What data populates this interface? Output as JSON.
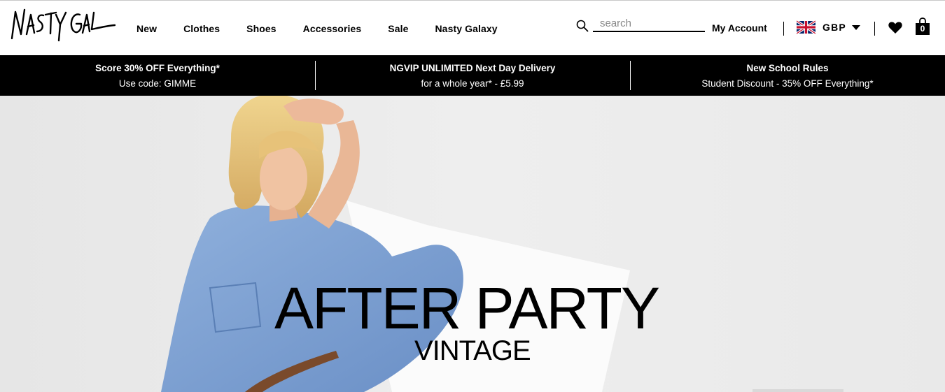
{
  "brand": {
    "logo_text": "NASTY GAL"
  },
  "nav": {
    "items": [
      {
        "label": "New"
      },
      {
        "label": "Clothes"
      },
      {
        "label": "Shoes"
      },
      {
        "label": "Accessories"
      },
      {
        "label": "Sale"
      },
      {
        "label": "Nasty Galaxy"
      }
    ]
  },
  "search": {
    "placeholder": "search",
    "icon": "search-icon"
  },
  "account": {
    "label": "My Account"
  },
  "locale": {
    "currency": "GBP",
    "flag": "uk-flag-icon"
  },
  "wishlist": {
    "icon": "heart-icon"
  },
  "cart": {
    "icon": "bag-icon",
    "count": "0"
  },
  "promos": [
    {
      "title": "Score 30% OFF Everything*",
      "subtitle": "Use code: GIMME"
    },
    {
      "title": "NGVIP UNLIMITED Next Day Delivery",
      "subtitle": "for a whole year* - £5.99"
    },
    {
      "title": "New School Rules",
      "subtitle": "Student Discount - 35% OFF Everything*"
    }
  ],
  "hero": {
    "title": "AFTER PARTY",
    "subtitle": "VINTAGE"
  },
  "colors": {
    "promo_bg": "#000000",
    "hero_bg": "#ebebeb",
    "denim": "#7b9fd0",
    "hair": "#e2bd74"
  }
}
